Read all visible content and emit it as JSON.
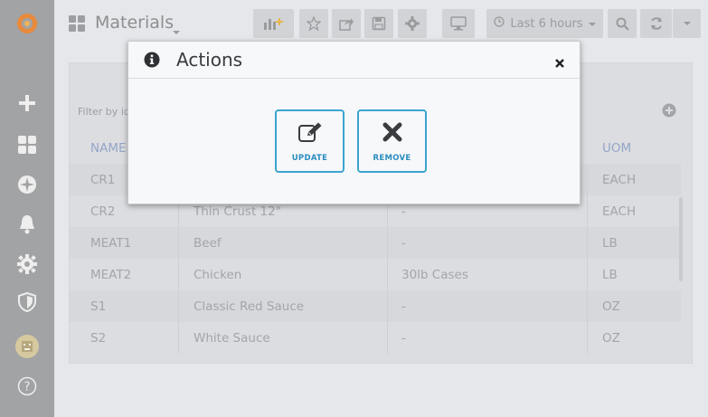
{
  "header": {
    "dashboard_title": "Materials",
    "time_range": "Last 6 hours"
  },
  "panel": {
    "filter_label": "Filter by id",
    "columns": [
      "NAME",
      "",
      "",
      "UOM"
    ],
    "rows": [
      {
        "name": "CR1",
        "description": "",
        "package": "",
        "uom": "EACH"
      },
      {
        "name": "CR2",
        "description": "Thin Crust 12\"",
        "package": "-",
        "uom": "EACH"
      },
      {
        "name": "MEAT1",
        "description": "Beef",
        "package": "-",
        "uom": "LB"
      },
      {
        "name": "MEAT2",
        "description": "Chicken",
        "package": "30lb Cases",
        "uom": "LB"
      },
      {
        "name": "S1",
        "description": "Classic Red Sauce",
        "package": "-",
        "uom": "OZ"
      },
      {
        "name": "S2",
        "description": "White Sauce",
        "package": "-",
        "uom": "OZ"
      }
    ]
  },
  "modal": {
    "title": "Actions",
    "update_label": "UPDATE",
    "remove_label": "REMOVE"
  },
  "colors": {
    "accent": "#3aa5cf",
    "sidebar": "#a2a3a5",
    "logo": "#e88a3c"
  },
  "icons": [
    "grafana-logo-icon",
    "plus-icon",
    "dashboards-icon",
    "explore-icon",
    "bell-icon",
    "gear-icon",
    "shield-icon",
    "user-avatar",
    "help-icon",
    "info-icon",
    "close-icon",
    "edit-icon",
    "remove-icon"
  ]
}
